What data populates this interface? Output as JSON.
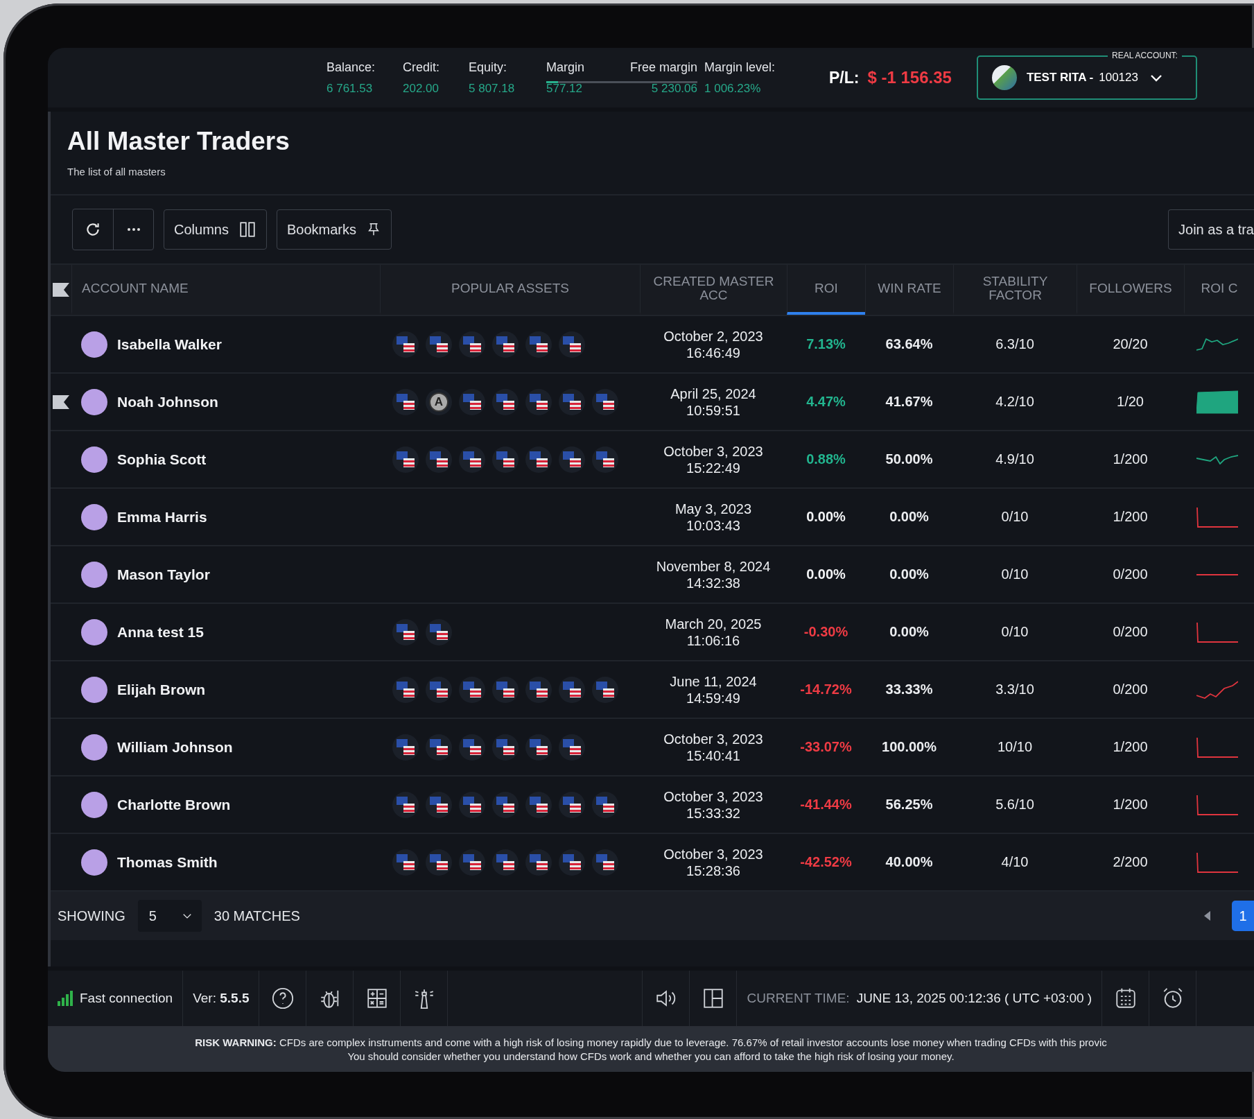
{
  "account_bar": {
    "stats": [
      {
        "label": "Balance:",
        "value": "6 761.53"
      },
      {
        "label": "Credit:",
        "value": "202.00"
      },
      {
        "label": "Equity:",
        "value": "5 807.18"
      },
      {
        "label": "Margin",
        "value": "577.12"
      },
      {
        "label": "Free margin",
        "value": "5 230.06"
      },
      {
        "label": "Margin level:",
        "value": "1 006.23%"
      }
    ],
    "margin_bar": {
      "level": 0.08
    },
    "pl_label": "P/L:",
    "pl_value": "$ -1 156.35",
    "account": {
      "legend": "REAL ACCOUNT:",
      "name": "TEST RITA -",
      "number": "100123"
    }
  },
  "page": {
    "title": "All Master Traders",
    "subtitle": "The list of all masters"
  },
  "toolbar": {
    "columns_label": "Columns",
    "bookmarks_label": "Bookmarks",
    "join_label": "Join as a tra"
  },
  "table": {
    "columns": [
      {
        "label": "ACCOUNT NAME",
        "selected": false
      },
      {
        "label": "POPULAR ASSETS",
        "selected": false
      },
      {
        "label": "CREATED MASTER ACC",
        "selected": false
      },
      {
        "label": "ROI",
        "selected": true
      },
      {
        "label": "WIN RATE",
        "selected": false
      },
      {
        "label": "STABILITY FACTOR",
        "selected": false
      },
      {
        "label": "FOLLOWERS",
        "selected": false
      },
      {
        "label": "ROI C",
        "selected": false
      }
    ],
    "rows": [
      {
        "name": "Isabella Walker",
        "bookmarked": false,
        "assets": [
          {
            "kind": "flag"
          },
          {
            "kind": "flag"
          },
          {
            "kind": "flag"
          },
          {
            "kind": "flag"
          },
          {
            "kind": "flag"
          },
          {
            "kind": "flag"
          }
        ],
        "date": "October 2, 2023",
        "time": "16:46:49",
        "roi": {
          "value": "7.13%",
          "color": "#22b58f"
        },
        "win_rate": "63.64%",
        "stability": "6.3/10",
        "followers": "20/20",
        "sparkline": {
          "kind": "rise",
          "color": "#1fa57f"
        }
      },
      {
        "name": "Noah Johnson",
        "bookmarked": true,
        "assets": [
          {
            "kind": "flag"
          },
          {
            "kind": "letter",
            "label": "A"
          },
          {
            "kind": "flag"
          },
          {
            "kind": "flag"
          },
          {
            "kind": "flag"
          },
          {
            "kind": "flag"
          },
          {
            "kind": "flag"
          }
        ],
        "date": "April 25, 2024",
        "time": "10:59:51",
        "roi": {
          "value": "4.47%",
          "color": "#22b58f"
        },
        "win_rate": "41.67%",
        "stability": "4.2/10",
        "followers": "1/20",
        "sparkline": {
          "kind": "area",
          "color": "#1fa57f"
        }
      },
      {
        "name": "Sophia Scott",
        "bookmarked": false,
        "assets": [
          {
            "kind": "flag"
          },
          {
            "kind": "flag"
          },
          {
            "kind": "flag"
          },
          {
            "kind": "flag"
          },
          {
            "kind": "flag"
          },
          {
            "kind": "flag"
          },
          {
            "kind": "flag"
          }
        ],
        "date": "October 3, 2023",
        "time": "15:22:49",
        "roi": {
          "value": "0.88%",
          "color": "#22b58f"
        },
        "win_rate": "50.00%",
        "stability": "4.9/10",
        "followers": "1/200",
        "sparkline": {
          "kind": "wave",
          "color": "#1fa57f"
        }
      },
      {
        "name": "Emma Harris",
        "bookmarked": false,
        "assets": [],
        "date": "May 3, 2023",
        "time": "10:03:43",
        "roi": {
          "value": "0.00%",
          "color": "#f2f3f5"
        },
        "win_rate": "0.00%",
        "stability": "0/10",
        "followers": "1/200",
        "sparkline": {
          "kind": "drop",
          "color": "#e0343e"
        }
      },
      {
        "name": "Mason Taylor",
        "bookmarked": false,
        "assets": [],
        "date": "November 8, 2024",
        "time": "14:32:38",
        "roi": {
          "value": "0.00%",
          "color": "#f2f3f5"
        },
        "win_rate": "0.00%",
        "stability": "0/10",
        "followers": "0/200",
        "sparkline": {
          "kind": "flat",
          "color": "#e0343e"
        }
      },
      {
        "name": "Anna test 15",
        "bookmarked": false,
        "assets": [
          {
            "kind": "flag"
          },
          {
            "kind": "flag"
          }
        ],
        "date": "March 20, 2025",
        "time": "11:06:16",
        "roi": {
          "value": "-0.30%",
          "color": "#ef3b44"
        },
        "win_rate": "0.00%",
        "stability": "0/10",
        "followers": "0/200",
        "sparkline": {
          "kind": "drop",
          "color": "#e0343e"
        }
      },
      {
        "name": "Elijah Brown",
        "bookmarked": false,
        "assets": [
          {
            "kind": "flag"
          },
          {
            "kind": "flag"
          },
          {
            "kind": "flag"
          },
          {
            "kind": "flag"
          },
          {
            "kind": "flag"
          },
          {
            "kind": "flag"
          },
          {
            "kind": "flag"
          }
        ],
        "date": "June 11, 2024",
        "time": "14:59:49",
        "roi": {
          "value": "-14.72%",
          "color": "#ef3b44"
        },
        "win_rate": "33.33%",
        "stability": "3.3/10",
        "followers": "0/200",
        "sparkline": {
          "kind": "climb",
          "color": "#e0343e"
        }
      },
      {
        "name": "William Johnson",
        "bookmarked": false,
        "assets": [
          {
            "kind": "flag"
          },
          {
            "kind": "flag"
          },
          {
            "kind": "flag"
          },
          {
            "kind": "flag"
          },
          {
            "kind": "flag"
          },
          {
            "kind": "flag"
          }
        ],
        "date": "October 3, 2023",
        "time": "15:40:41",
        "roi": {
          "value": "-33.07%",
          "color": "#ef3b44"
        },
        "win_rate": "100.00%",
        "stability": "10/10",
        "followers": "1/200",
        "sparkline": {
          "kind": "drop",
          "color": "#e0343e"
        }
      },
      {
        "name": "Charlotte Brown",
        "bookmarked": false,
        "assets": [
          {
            "kind": "flag"
          },
          {
            "kind": "flag"
          },
          {
            "kind": "flag"
          },
          {
            "kind": "flag"
          },
          {
            "kind": "flag"
          },
          {
            "kind": "flag"
          },
          {
            "kind": "flag"
          }
        ],
        "date": "October 3, 2023",
        "time": "15:33:32",
        "roi": {
          "value": "-41.44%",
          "color": "#ef3b44"
        },
        "win_rate": "56.25%",
        "stability": "5.6/10",
        "followers": "1/200",
        "sparkline": {
          "kind": "drop",
          "color": "#e0343e"
        }
      },
      {
        "name": "Thomas Smith",
        "bookmarked": false,
        "assets": [
          {
            "kind": "flag"
          },
          {
            "kind": "flag"
          },
          {
            "kind": "flag"
          },
          {
            "kind": "flag"
          },
          {
            "kind": "flag"
          },
          {
            "kind": "flag"
          },
          {
            "kind": "flag"
          }
        ],
        "date": "October 3, 2023",
        "time": "15:28:36",
        "roi": {
          "value": "-42.52%",
          "color": "#ef3b44"
        },
        "win_rate": "40.00%",
        "stability": "4/10",
        "followers": "2/200",
        "sparkline": {
          "kind": "drop",
          "color": "#e0343e"
        }
      }
    ]
  },
  "pagination": {
    "showing_label": "SHOWING",
    "page_size": "5",
    "matches": "30 MATCHES",
    "pages": [
      {
        "label": "1",
        "selected": true
      }
    ]
  },
  "status_bar": {
    "connection": "Fast connection",
    "version": "Ver: **5.5.5**",
    "time_label": "CURRENT TIME:",
    "time_value": "JUNE 13, 2025 00:12:36 ( UTC +03:00 )"
  },
  "risk_warning": [
    "**RISK WARNING:** CFDs are complex instruments and come with a high risk of losing money rapidly due to leverage. 76.67% of retail investor accounts lose money when trading CFDs with this provic",
    "You should consider whether you understand how CFDs work and whether you can afford to take the high risk of losing your money."
  ]
}
